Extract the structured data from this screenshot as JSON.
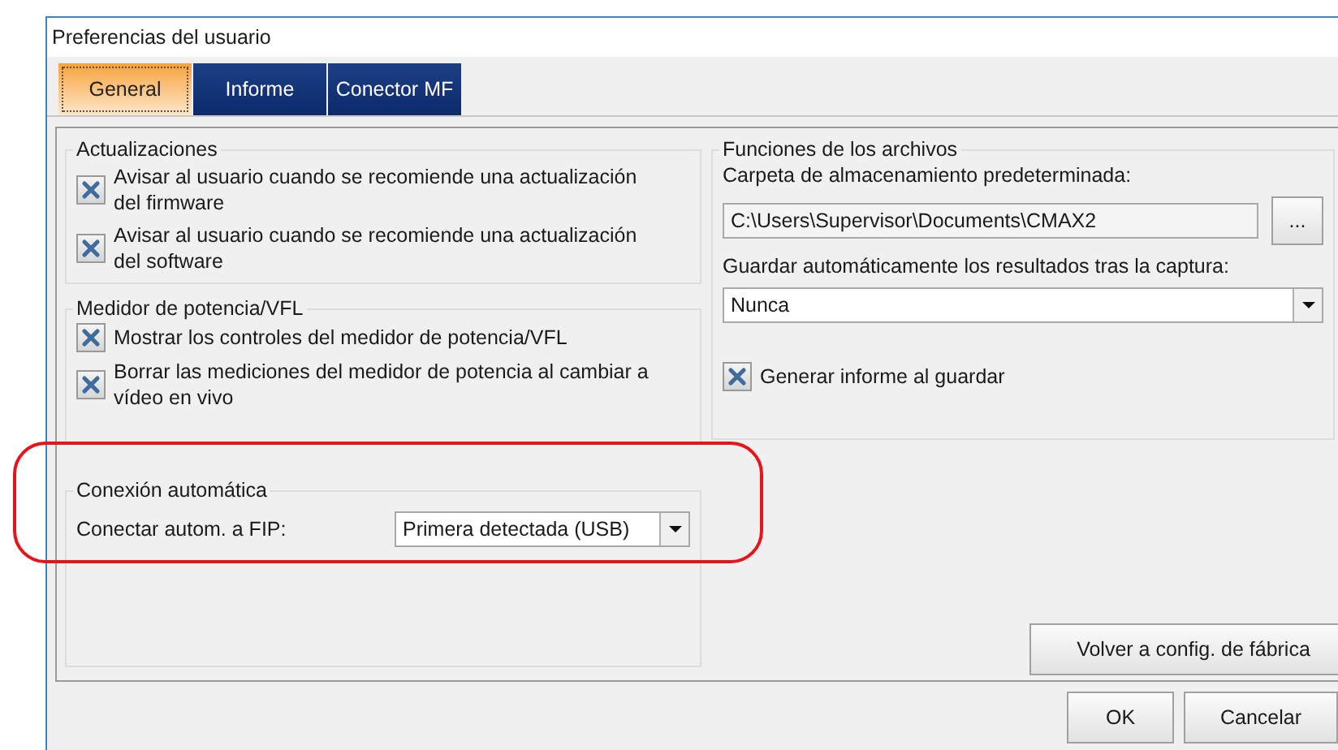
{
  "window": {
    "title": "Preferencias del usuario"
  },
  "tabs": [
    {
      "label": "General",
      "selected": true
    },
    {
      "label": "Informe",
      "selected": false
    },
    {
      "label": "Conector MF",
      "selected": false
    }
  ],
  "updates": {
    "title": "Actualizaciones",
    "options": [
      {
        "label": "Avisar al usuario cuando se recomiende una actualización del firmware",
        "checked": true
      },
      {
        "label": "Avisar al usuario cuando se recomiende una actualización del software",
        "checked": true
      }
    ]
  },
  "power_meter": {
    "title": "Medidor de potencia/VFL",
    "options": [
      {
        "label": "Mostrar los controles del medidor de potencia/VFL",
        "checked": true
      },
      {
        "label": "Borrar las mediciones del medidor de potencia al cambiar a vídeo en vivo",
        "checked": true
      }
    ]
  },
  "auto_connect": {
    "title": "Conexión automática",
    "label": "Conectar autom. a FIP:",
    "value": "Primera detectada (USB)"
  },
  "files": {
    "title": "Funciones de los archivos",
    "folder_label": "Carpeta de almacenamiento predeterminada:",
    "folder_value": "C:\\Users\\Supervisor\\Documents\\CMAX2",
    "browse": "...",
    "autosave_label": "Guardar automáticamente los resultados tras la captura:",
    "autosave_value": "Nunca",
    "report_option": {
      "label": "Generar informe al guardar",
      "checked": true
    }
  },
  "factory_button": "Volver a config. de fábrica",
  "buttons": [
    "OK",
    "Cancelar"
  ]
}
